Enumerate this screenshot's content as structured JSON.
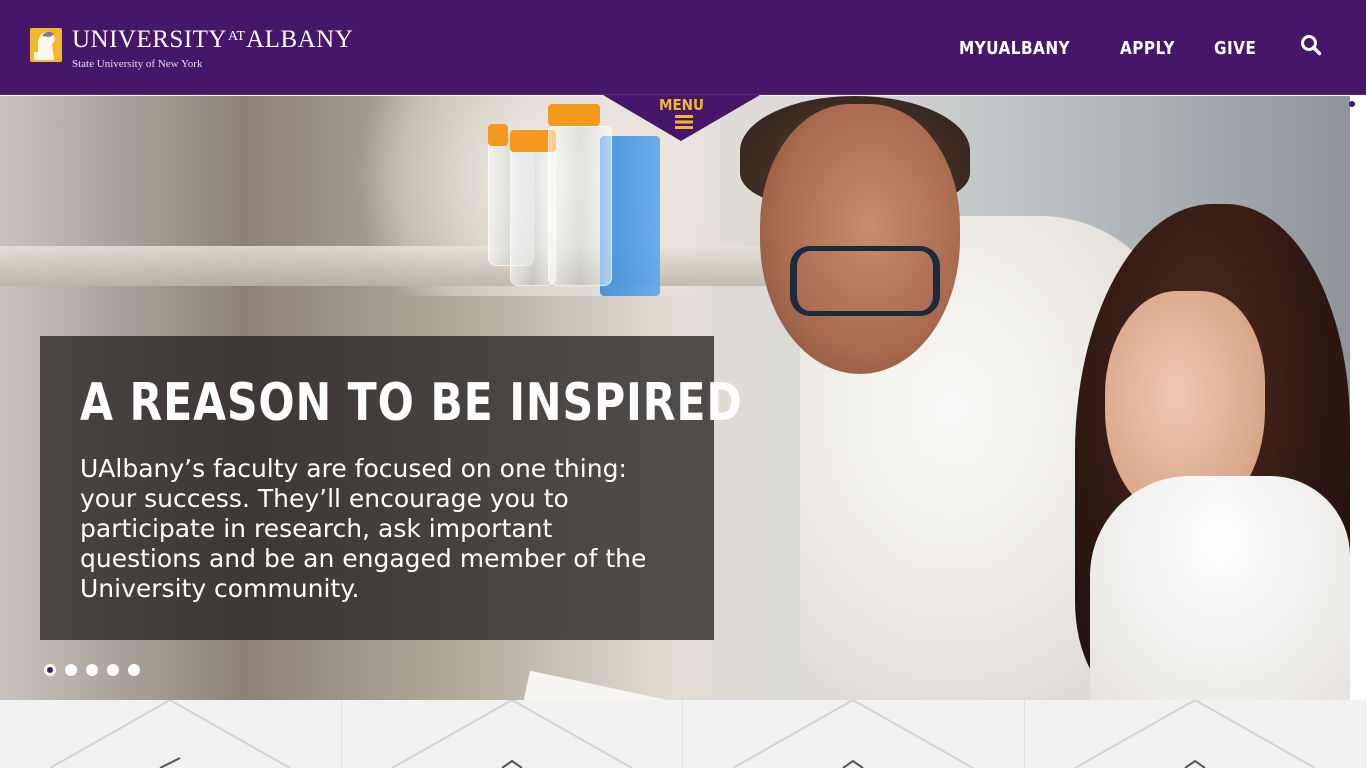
{
  "header": {
    "logo": {
      "main_before": "UNIVERSITY",
      "main_at": "AT",
      "main_after": "ALBANY",
      "subtitle": "State University of New York"
    },
    "nav": [
      {
        "label": "MYUALBANY"
      },
      {
        "label": "APPLY"
      },
      {
        "label": "GIVE"
      }
    ],
    "search_icon": "search-icon",
    "menu_label": "MENU",
    "menu_icon": "hamburger-icon"
  },
  "hero": {
    "title": "A REASON TO BE INSPIRED",
    "body": "UAlbany’s faculty are focused on one thing: your success. They’ll encourage you to participate in research, ask important questions and be an engaged member of the University community.",
    "slides_total": 5,
    "active_slide": 1
  },
  "colors": {
    "brand_purple": "#46166b",
    "brand_gold": "#f1b82d",
    "tile_bg": "#f1f1f1"
  },
  "tiles": [
    {
      "icon": "chevron-icon"
    },
    {
      "icon": "chevron-icon"
    },
    {
      "icon": "chevron-icon"
    },
    {
      "icon": "chevron-icon"
    }
  ]
}
